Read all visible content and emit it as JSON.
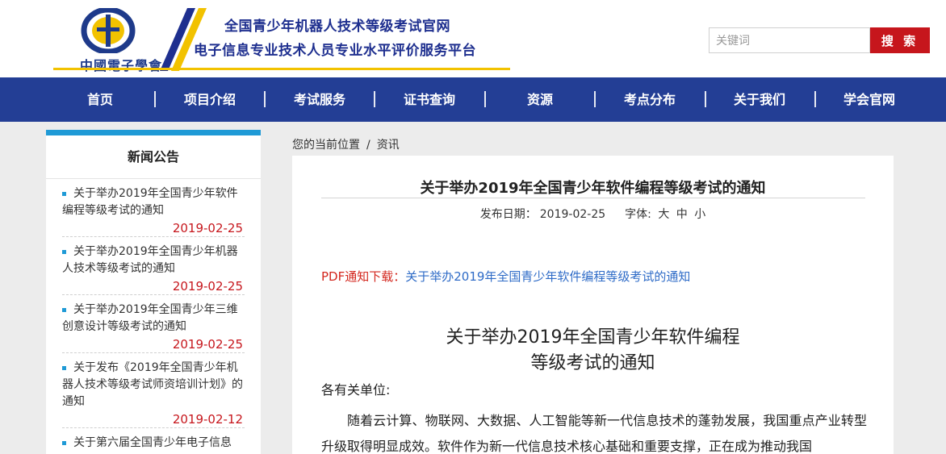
{
  "header": {
    "logo_text": "中國電子學會",
    "title_line1": "全国青少年机器人技术等级考试官网",
    "title_line2": "电子信息专业技术人员专业水平评价服务平台",
    "colors": {
      "brand_blue": "#1e2f8f",
      "accent_yellow": "#f2c200"
    }
  },
  "search": {
    "placeholder": "关键词",
    "button_label": "搜 索",
    "button_color": "#c6161c"
  },
  "nav": {
    "background": "#233e95",
    "items": [
      "首页",
      "项目介绍",
      "考试服务",
      "证书查询",
      "资源",
      "考点分布",
      "关于我们",
      "学会官网"
    ]
  },
  "sidebar": {
    "title": "新闻公告",
    "items": [
      {
        "title": "关于举办2019年全国青少年软件编程等级考试的通知",
        "date": "2019-02-25"
      },
      {
        "title": "关于举办2019年全国青少年机器人技术等级考试的通知",
        "date": "2019-02-25"
      },
      {
        "title": "关于举办2019年全国青少年三维创意设计等级考试的通知",
        "date": "2019-02-25"
      },
      {
        "title": "关于发布《2019年全国青少年机器人技术等级考试师资培训计划》的通知",
        "date": "2019-02-12"
      },
      {
        "title": "关于第六届全国青少年电子信息",
        "date": ""
      }
    ]
  },
  "breadcrumb": {
    "prefix": "您的当前位置",
    "separator": "/",
    "current": "资讯"
  },
  "article": {
    "title": "关于举办2019年全国青少年软件编程等级考试的通知",
    "publish_label": "发布日期：",
    "publish_date": "2019-02-25",
    "font_label": "字体:",
    "font_large": "大",
    "font_medium": "中",
    "font_small": "小",
    "pdf_label": "PDF通知下载：",
    "pdf_link": "关于举办2019年全国青少年软件编程等级考试的通知",
    "heading_line1": "关于举办2019年全国青少年软件编程",
    "heading_line2": "等级考试的通知",
    "salutation": "各有关单位:",
    "body": "随着云计算、物联网、大数据、人工智能等新一代信息技术的蓬勃发展，我国重点产业转型升级取得明显成效。软件作为新一代信息技术核心基础和重要支撑，正在成为推动我国"
  }
}
